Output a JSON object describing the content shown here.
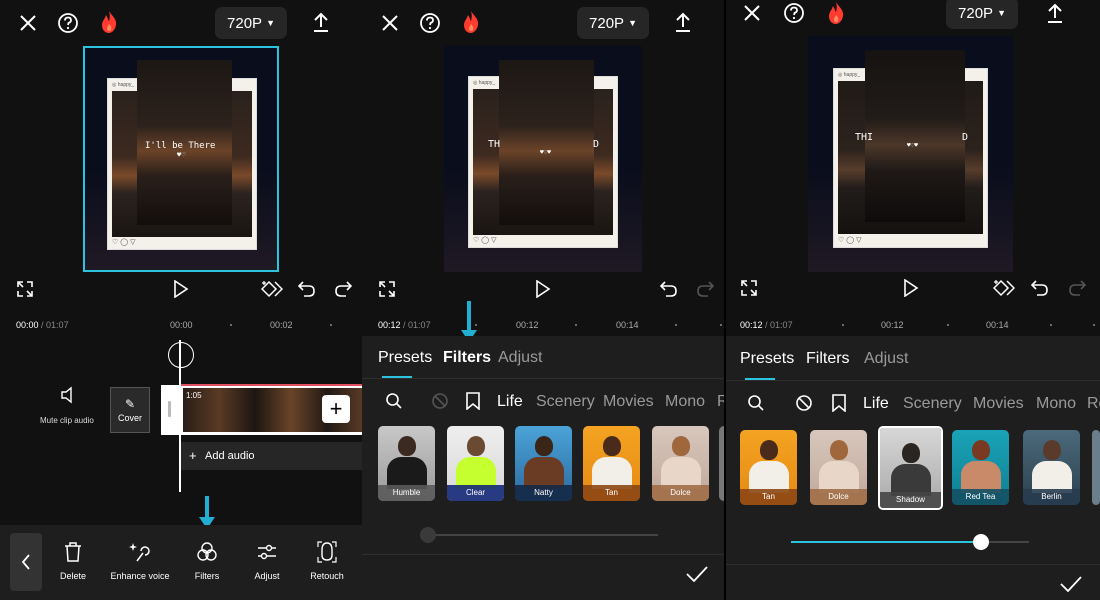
{
  "accent": "#2bc3de",
  "icons": {
    "close": "close-icon",
    "help": "help-icon",
    "flame": "flame-icon",
    "export": "export-icon",
    "fullscreen": "fullscreen-icon",
    "play": "play-icon",
    "keyframe": "keyframe-icon",
    "undo": "undo-icon",
    "redo": "redo-icon"
  },
  "panel1": {
    "resolution": "720P",
    "time_current": "00:00",
    "time_total": "/ 01:07",
    "ticks": [
      "00:00",
      "00:02"
    ],
    "overlay_text": "I'll be There",
    "mute_label": "Mute clip audio",
    "cover_label": "Cover",
    "clip_duration": "1:05",
    "add_audio": "Add audio",
    "tools": [
      {
        "label": "Delete",
        "icon": "trash-icon"
      },
      {
        "label": "Enhance voice",
        "icon": "enhance-voice-icon"
      },
      {
        "label": "Filters",
        "icon": "filters-icon"
      },
      {
        "label": "Adjust",
        "icon": "adjust-icon"
      },
      {
        "label": "Retouch",
        "icon": "retouch-icon"
      }
    ]
  },
  "panel2": {
    "resolution": "720P",
    "time_current": "00:12",
    "time_total": "/ 01:07",
    "ticks": [
      "00:12",
      "00:14"
    ],
    "tabs": [
      "Presets",
      "Filters",
      "Adjust"
    ],
    "active_tab": "Presets",
    "categories": [
      "Life",
      "Scenery",
      "Movies",
      "Mono",
      "R"
    ],
    "active_category": "Life",
    "filters": [
      "Humble",
      "Clear",
      "Natty",
      "Tan",
      "Dolce"
    ],
    "overlay_left": "TH",
    "overlay_right": "D"
  },
  "panel3": {
    "resolution": "720P",
    "time_current": "00:12",
    "time_total": "/ 01:07",
    "ticks": [
      "00:12",
      "00:14"
    ],
    "tabs": [
      "Presets",
      "Filters",
      "Adjust"
    ],
    "active_tab": "Presets",
    "categories": [
      "Life",
      "Scenery",
      "Movies",
      "Mono",
      "Re"
    ],
    "active_category": "Life",
    "filters": [
      "Tan",
      "Dolce",
      "Shadow",
      "Red Tea",
      "Berlin"
    ],
    "selected_filter": "Shadow",
    "intensity": 0.8,
    "overlay_left": "THI",
    "overlay_right": "D"
  }
}
